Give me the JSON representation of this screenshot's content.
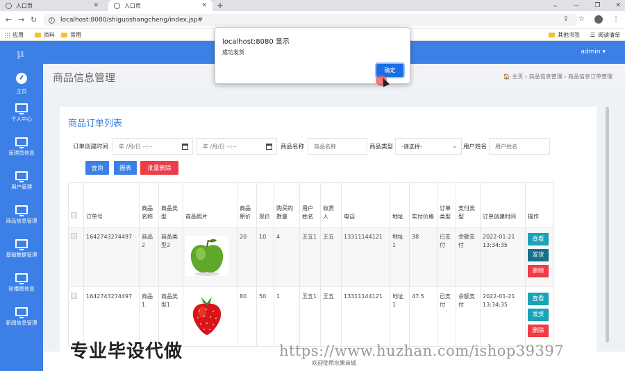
{
  "browser": {
    "tabs": [
      {
        "label": "入口页",
        "active": false
      },
      {
        "label": "入口页",
        "active": true
      }
    ],
    "new_tab": "+",
    "window_controls": [
      "⌄",
      "—",
      "❐",
      "✕"
    ],
    "url": "localhost:8080/shiguoshangcheng/index.jsp#",
    "bookmarks": {
      "apps": "应用",
      "items": [
        "资料",
        "常用"
      ],
      "other": "其他书签",
      "reading": "阅读清单"
    }
  },
  "app": {
    "logo": "μ",
    "user": "admin ▾",
    "sidebar": [
      {
        "label": "主页",
        "icon": "dashboard-icon"
      },
      {
        "label": "个人中心",
        "icon": "monitor-icon"
      },
      {
        "label": "管理员信息",
        "icon": "monitor-icon"
      },
      {
        "label": "用户管理",
        "icon": "monitor-icon"
      },
      {
        "label": "商品信息管理",
        "icon": "monitor-icon"
      },
      {
        "label": "基础数据管理",
        "icon": "monitor-icon"
      },
      {
        "label": "轮播图信息",
        "icon": "monitor-icon"
      },
      {
        "label": "新闻信息管理",
        "icon": "monitor-icon"
      }
    ],
    "page_title": "商品信息管理",
    "breadcrumb": "🏠 主页   ›   商品信息管理   ›   商品信息订单管理",
    "card_title": "商品订单列表",
    "filters": {
      "create_time_label": "订单创建时间",
      "date1_placeholder": "年 /月/日 --:--",
      "date2_placeholder": "年 /月/日 --:--",
      "product_name_label": "商品名称",
      "product_name_placeholder": "商品名称",
      "product_type_label": "商品类型",
      "product_type_value": "-请选择-",
      "user_name_label": "用户姓名",
      "user_name_placeholder": "用户姓名"
    },
    "buttons": {
      "search": "查询",
      "report": "报表",
      "batch_delete": "批量删除"
    },
    "table": {
      "headers": [
        "",
        "订单号",
        "商品名称",
        "商品类型",
        "商品照片",
        "商品原价",
        "现价",
        "购买的数量",
        "用户姓名",
        "收货人",
        "电话",
        "地址",
        "实付价格",
        "订单类型",
        "支付类型",
        "订单创建时间",
        "操作"
      ],
      "rows": [
        {
          "order_no": "1642743274497",
          "name": "商品2",
          "type": "商品类型2",
          "photo": "apple-photo",
          "orig": "20",
          "price": "10",
          "qty": "4",
          "user": "王五1",
          "receiver": "王五",
          "phone": "13311144121",
          "address": "地址1",
          "paid": "38",
          "order_type": "已支付",
          "pay_type": "余额支付",
          "created": "2022-01-21 13:34:35"
        },
        {
          "order_no": "1642743274497",
          "name": "商品1",
          "type": "商品类型1",
          "photo": "strawberry-photo",
          "orig": "80",
          "price": "50",
          "qty": "1",
          "user": "王五1",
          "receiver": "王五",
          "phone": "13311144121",
          "address": "地址1",
          "paid": "47.5",
          "order_type": "已支付",
          "pay_type": "余额支付",
          "created": "2022-01-21 13:34:35"
        }
      ],
      "ops": {
        "view": "查看",
        "ship": "发货",
        "delete": "删除"
      }
    },
    "footer": "欢迎使用水果商城"
  },
  "dialog": {
    "title": "localhost:8080 显示",
    "message": "成功发货",
    "ok": "确定"
  },
  "watermarks": {
    "left": "专业毕设代做",
    "right": "https://www.huzhan.com/ishop39397"
  }
}
